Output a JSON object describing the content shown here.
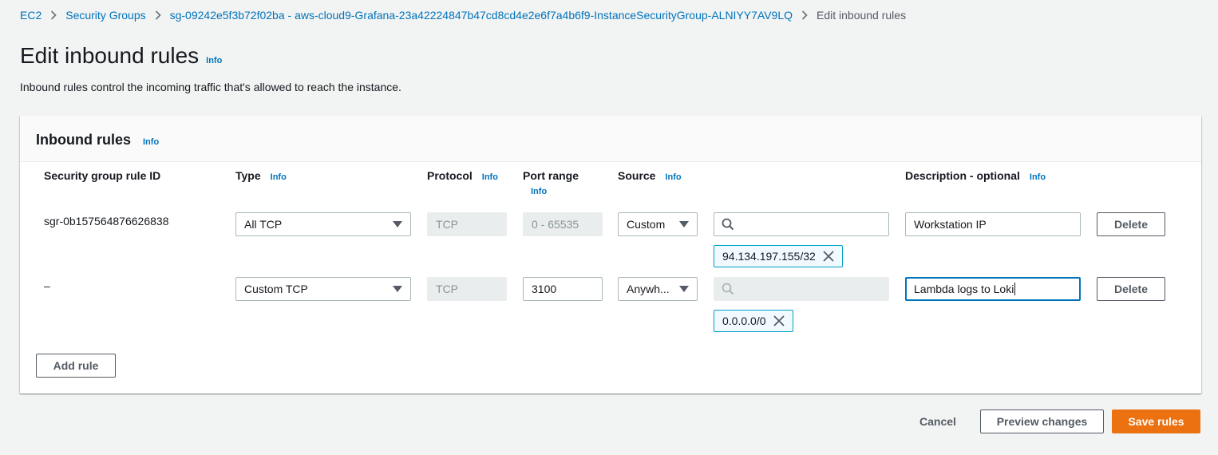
{
  "breadcrumb": {
    "items": [
      {
        "label": "EC2"
      },
      {
        "label": "Security Groups"
      },
      {
        "label": "sg-09242e5f3b72f02ba - aws-cloud9-Grafana-23a42224847b47cd8cd4e2e6f7a4b6f9-InstanceSecurityGroup-ALNIYY7AV9LQ"
      },
      {
        "label": "Edit inbound rules"
      }
    ]
  },
  "page": {
    "title": "Edit inbound rules",
    "info": "Info",
    "description": "Inbound rules control the incoming traffic that's allowed to reach the instance."
  },
  "rules_panel": {
    "title": "Inbound rules",
    "info": "Info",
    "columns": {
      "rule_id": "Security group rule ID",
      "type": "Type",
      "protocol": "Protocol",
      "port_range": "Port range",
      "source": "Source",
      "description": "Description - optional",
      "info": "Info"
    },
    "rows": [
      {
        "rule_id": "sgr-0b157564876626838",
        "type": "All TCP",
        "protocol": "TCP",
        "port_range": "0 - 65535",
        "source": "Custom",
        "search_value": "",
        "cidr": "94.134.197.155/32",
        "description": "Workstation IP",
        "delete_label": "Delete"
      },
      {
        "rule_id": "–",
        "type": "Custom TCP",
        "protocol": "TCP",
        "port_range": "3100",
        "source": "Anywh...",
        "search_value": "",
        "cidr": "0.0.0.0/0",
        "description": "Lambda logs to Loki",
        "delete_label": "Delete"
      }
    ],
    "add_rule_label": "Add rule"
  },
  "footer": {
    "cancel_label": "Cancel",
    "preview_label": "Preview changes",
    "save_label": "Save rules"
  },
  "colors": {
    "link": "#0073bb",
    "primary": "#ec7211",
    "token_border": "#00a1c9",
    "focus": "#0073bb"
  }
}
